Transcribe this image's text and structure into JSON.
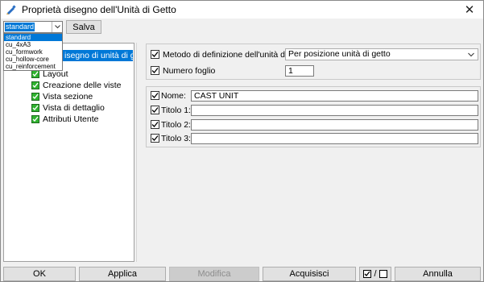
{
  "window": {
    "title": "Proprietà disegno dell'Unità di Getto",
    "close_glyph": "✕",
    "icon": "drawing-app-icon"
  },
  "toolbar": {
    "preset_value": "standard",
    "save_label": "Salva"
  },
  "preset_dropdown": {
    "options": [
      "standard",
      "cu_4xA3",
      "cu_formwork",
      "cu_hollow-core",
      "cu_reinforcement"
    ],
    "selected_index": 0
  },
  "tree": {
    "root_label": "isegno di unità di getto",
    "items": [
      {
        "label": "Layout",
        "checked": true
      },
      {
        "label": "Creazione delle viste",
        "checked": true
      },
      {
        "label": "Vista sezione",
        "checked": true
      },
      {
        "label": "Vista di dettaglio",
        "checked": true
      },
      {
        "label": "Attributi Utente",
        "checked": true
      }
    ]
  },
  "definition": {
    "method_label": "Metodo di definizione dell'unità di getto",
    "method_value": "Per posizione unità di getto",
    "sheet_number_label": "Numero foglio",
    "sheet_number_value": "1"
  },
  "titles": {
    "name_label": "Nome:",
    "name_value": "CAST UNIT",
    "title1_label": "Titolo 1:",
    "title2_label": "Titolo 2:",
    "title3_label": "Titolo 3:",
    "title1_value": "",
    "title2_value": "",
    "title3_value": ""
  },
  "buttons": {
    "ok": "OK",
    "apply": "Applica",
    "modify": "Modifica",
    "get": "Acquisisci",
    "toggle_separator": "/",
    "cancel": "Annulla"
  },
  "colors": {
    "selection": "#0078d7",
    "check_green": "#2fb32f"
  }
}
